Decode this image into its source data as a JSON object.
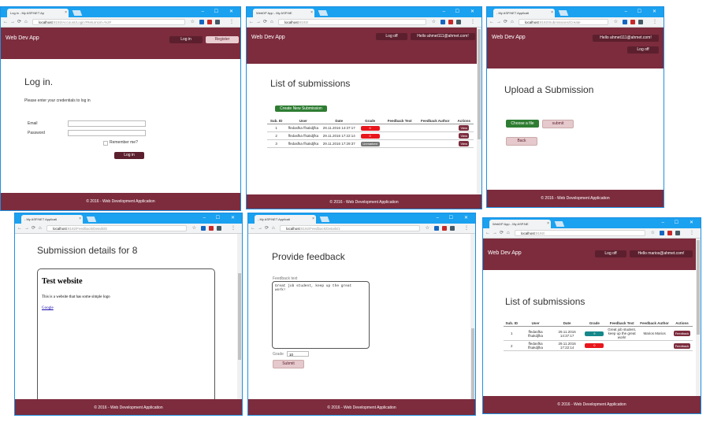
{
  "colors": {
    "header": "#7c2c3d",
    "dark_button": "#5c1f2d",
    "titlebar": "#1aa1f0",
    "green": "#2e7d32",
    "red": "#e8161c",
    "teal": "#16888a",
    "gray_badge": "#777777"
  },
  "common": {
    "brand": "Web Dev App",
    "footer": "© 2016 - Web Development Application",
    "url_host": "localhost"
  },
  "w1": {
    "tab": "Log in - My ASP.NET Ap",
    "url_path": ":8192/Account/Login?ReturnUrl=%2F",
    "login_btn": "Log in",
    "register_btn": "Register",
    "title": "Log in.",
    "subtitle": "Please enter your credentials to log in",
    "email_label": "Email",
    "password_label": "Password",
    "remember": "Remember me?",
    "submit": "Log in"
  },
  "w2": {
    "tab": "WebDP App - My ASP.NE",
    "url_path": ":8192/",
    "logoff": "Log off",
    "hello": "Hello ahmet111@ahmet.com!",
    "title": "List of submissions",
    "create": "Create New Submission",
    "headers": [
      "Sub. ID",
      "User",
      "Date",
      "Grade",
      "Feedback Text",
      "Feedback Author",
      "Actions"
    ],
    "rows": [
      {
        "id": "1",
        "user": "ffedasfka ffsakdjfka",
        "date": "29.11.2016 14:37:17",
        "grade": "0",
        "grade_type": "red",
        "fb_text": "",
        "fb_author": "",
        "action": "View"
      },
      {
        "id": "2",
        "user": "ffedasfka ffsakdjfka",
        "date": "29.11.2016 17:22:14",
        "grade": "0",
        "grade_type": "red",
        "fb_text": "",
        "fb_author": "",
        "action": "View"
      },
      {
        "id": "3",
        "user": "ffedasfka ffsakdjfka",
        "date": "29.11.2016 17:29:37",
        "grade": "Unmarked",
        "grade_type": "gray",
        "fb_text": "",
        "fb_author": "",
        "action": "View"
      }
    ]
  },
  "w3": {
    "tab": "- My ASP.NET Applicati",
    "url_path": ":8192/Submissions/Create",
    "hello": "Hello ahmet111@ahmet.com!",
    "logoff": "Log off",
    "title": "Upload a Submission",
    "choose": "Choose a file",
    "submit": "submit",
    "back": "Back"
  },
  "w4": {
    "tab": "- My ASP.NET Applicati",
    "url_path": ":8192/Feedback/Details/8",
    "title": "Submission details for 8",
    "card_title": "Test website",
    "card_text": "This is a website that has some simple logo",
    "card_link": "Google"
  },
  "w5": {
    "tab": "- My ASP.NET Applicati",
    "url_path": ":8192/Feedback/Details/1",
    "title": "Provide feedback",
    "label": "Feedback text",
    "feedback": "Great job student, keep up the great work!",
    "grade_label": "Grade",
    "grade_value": "10",
    "submit": "Submit"
  },
  "w6": {
    "tab": "WebDP App - My ASP.NE",
    "url_path": ":8192/",
    "logoff": "Log off",
    "hello": "Hello marios@ahmet.com!",
    "title": "List of submissions",
    "headers": [
      "Sub. ID",
      "User",
      "Date",
      "Grade",
      "Feedback Text",
      "Feedback Author",
      "Actions"
    ],
    "rows": [
      {
        "id": "1",
        "user": "ffedasfka ffsakdjfka",
        "date": "29.11.2016 14:37:17",
        "grade": "9",
        "grade_type": "teal",
        "fb_text": "Great job student, keep up the great work!",
        "fb_author": "Marios Marios",
        "action": "Feedback"
      },
      {
        "id": "2",
        "user": "ffedasfka ffsakdjfka",
        "date": "29.11.2016 17:22:14",
        "grade": "0",
        "grade_type": "red",
        "fb_text": "",
        "fb_author": "",
        "action": "Feedback"
      }
    ]
  }
}
